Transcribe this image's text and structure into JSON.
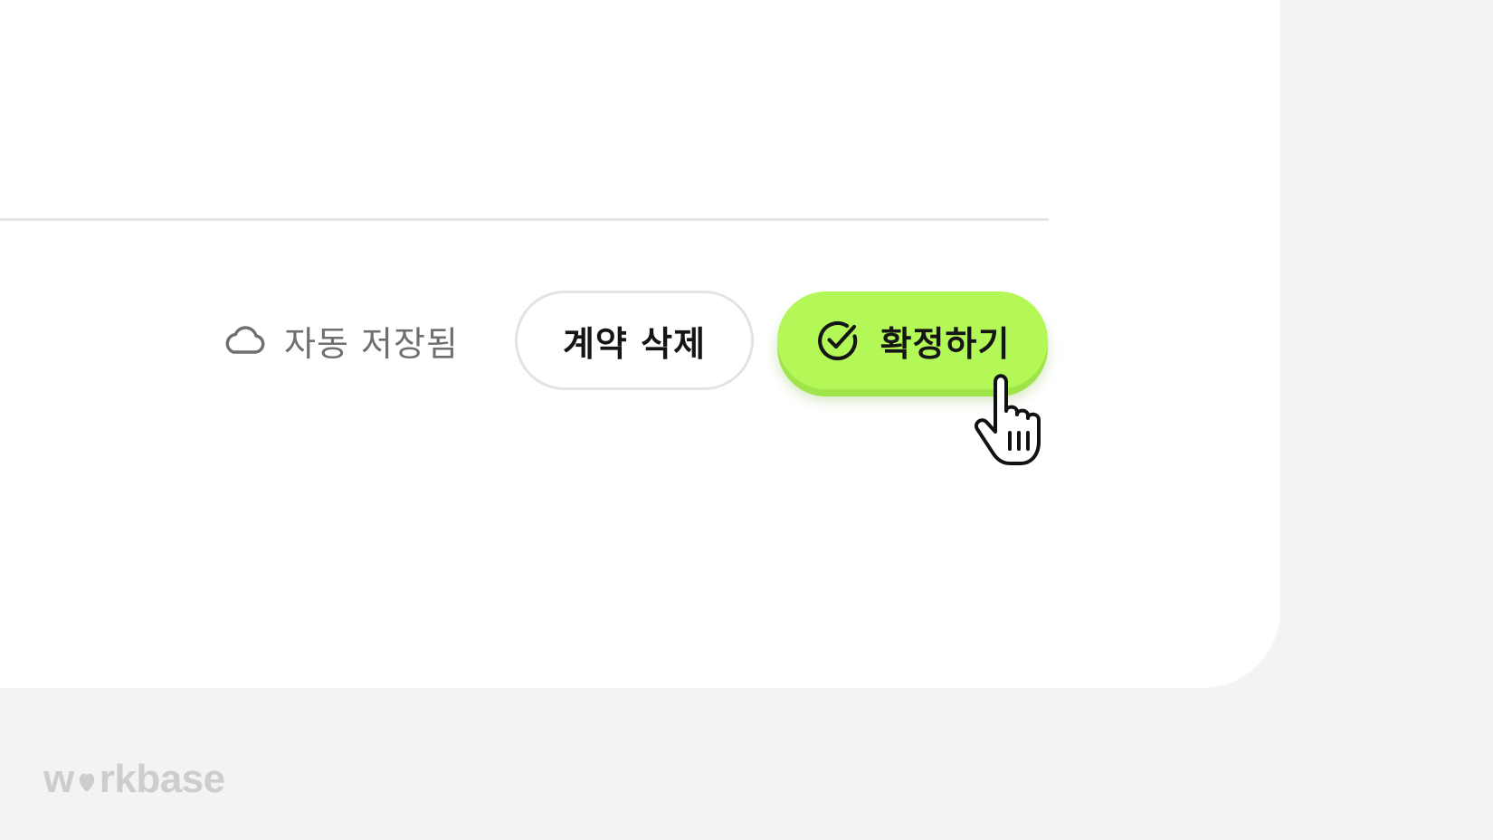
{
  "footer": {
    "autosave_label": "자동 저장됨",
    "delete_button_label": "계약 삭제",
    "confirm_button_label": "확정하기"
  },
  "icons": {
    "autosave": "cloud-icon",
    "confirm": "check-circle-icon",
    "cursor": "hand-pointer-cursor-icon"
  },
  "brand": {
    "logo_prefix": "w",
    "logo_suffix": "rkbase"
  },
  "colors": {
    "accent": "#b4f857",
    "panel_background": "#ffffff",
    "page_background": "#f3f3f3",
    "muted_text": "#6f6f6f"
  }
}
